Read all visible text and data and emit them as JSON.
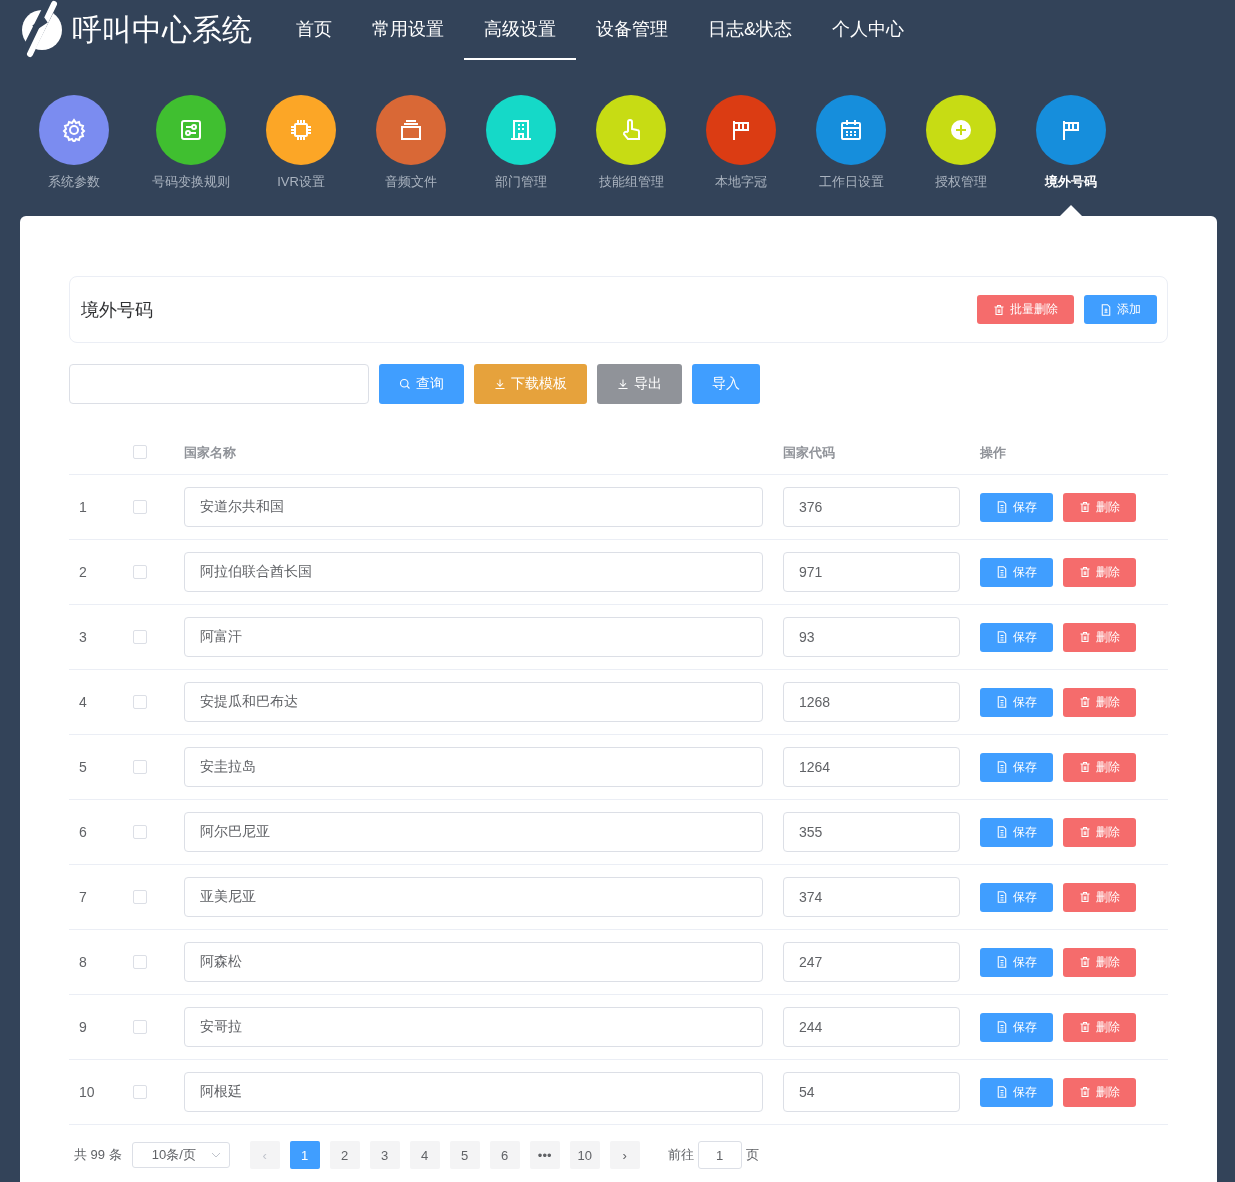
{
  "app": {
    "title": "呼叫中心系统"
  },
  "nav": [
    {
      "label": "首页",
      "selected": false
    },
    {
      "label": "常用设置",
      "selected": false
    },
    {
      "label": "高级设置",
      "selected": true
    },
    {
      "label": "设备管理",
      "selected": false
    },
    {
      "label": "日志&状态",
      "selected": false
    },
    {
      "label": "个人中心",
      "selected": false
    }
  ],
  "modules": [
    {
      "label": "系统参数",
      "color": "#7b8cf0",
      "selected": false
    },
    {
      "label": "号码变换规则",
      "color": "#40bf30",
      "selected": false
    },
    {
      "label": "IVR设置",
      "color": "#fca626",
      "selected": false
    },
    {
      "label": "音频文件",
      "color": "#d96836",
      "selected": false
    },
    {
      "label": "部门管理",
      "color": "#15d9c8",
      "selected": false
    },
    {
      "label": "技能组管理",
      "color": "#c7dc14",
      "selected": false
    },
    {
      "label": "本地字冠",
      "color": "#db3c13",
      "selected": false
    },
    {
      "label": "工作日设置",
      "color": "#168edc",
      "selected": false
    },
    {
      "label": "授权管理",
      "color": "#c7dc14",
      "selected": false
    },
    {
      "label": "境外号码",
      "color": "#168edc",
      "selected": true
    }
  ],
  "panel": {
    "title": "境外号码",
    "actions": [
      {
        "label": "批量删除",
        "kind": "danger"
      },
      {
        "label": "添加",
        "kind": "primary"
      }
    ]
  },
  "toolbar": {
    "buttons": [
      {
        "label": "查询",
        "kind": "primary"
      },
      {
        "label": "下载模板",
        "kind": "warning"
      },
      {
        "label": "导出",
        "kind": "info"
      },
      {
        "label": "导入",
        "kind": "primary"
      }
    ]
  },
  "table": {
    "columns": [
      "国家名称",
      "国家代码",
      "操作"
    ],
    "header_checked": false,
    "rows": [
      {
        "index": "1",
        "checked": false,
        "name": "安道尔共和国",
        "code": "376",
        "actions": [
          {
            "label": "保存",
            "kind": "primary"
          },
          {
            "label": "删除",
            "kind": "danger"
          }
        ]
      },
      {
        "index": "2",
        "checked": false,
        "name": "阿拉伯联合酋长国",
        "code": "971",
        "actions": [
          {
            "label": "保存",
            "kind": "primary"
          },
          {
            "label": "删除",
            "kind": "danger"
          }
        ]
      },
      {
        "index": "3",
        "checked": false,
        "name": "阿富汗",
        "code": "93",
        "actions": [
          {
            "label": "保存",
            "kind": "primary"
          },
          {
            "label": "删除",
            "kind": "danger"
          }
        ]
      },
      {
        "index": "4",
        "checked": false,
        "name": "安提瓜和巴布达",
        "code": "1268",
        "actions": [
          {
            "label": "保存",
            "kind": "primary"
          },
          {
            "label": "删除",
            "kind": "danger"
          }
        ]
      },
      {
        "index": "5",
        "checked": false,
        "name": "安圭拉岛",
        "code": "1264",
        "actions": [
          {
            "label": "保存",
            "kind": "primary"
          },
          {
            "label": "删除",
            "kind": "danger"
          }
        ]
      },
      {
        "index": "6",
        "checked": false,
        "name": "阿尔巴尼亚",
        "code": "355",
        "actions": [
          {
            "label": "保存",
            "kind": "primary"
          },
          {
            "label": "删除",
            "kind": "danger"
          }
        ]
      },
      {
        "index": "7",
        "checked": false,
        "name": "亚美尼亚",
        "code": "374",
        "actions": [
          {
            "label": "保存",
            "kind": "primary"
          },
          {
            "label": "删除",
            "kind": "danger"
          }
        ]
      },
      {
        "index": "8",
        "checked": false,
        "name": "阿森松",
        "code": "247",
        "actions": [
          {
            "label": "保存",
            "kind": "primary"
          },
          {
            "label": "删除",
            "kind": "danger"
          }
        ]
      },
      {
        "index": "9",
        "checked": false,
        "name": "安哥拉",
        "code": "244",
        "actions": [
          {
            "label": "保存",
            "kind": "primary"
          },
          {
            "label": "删除",
            "kind": "danger"
          }
        ]
      },
      {
        "index": "10",
        "checked": false,
        "name": "阿根廷",
        "code": "54",
        "actions": [
          {
            "label": "保存",
            "kind": "primary"
          },
          {
            "label": "删除",
            "kind": "danger"
          }
        ]
      }
    ]
  },
  "pagination": {
    "total": "共 99 条",
    "page_size": "10条/页",
    "prev": "‹",
    "next": "›",
    "pages": [
      {
        "label": "1",
        "selected": true
      },
      {
        "label": "2",
        "selected": false
      },
      {
        "label": "3",
        "selected": false
      },
      {
        "label": "4",
        "selected": false
      },
      {
        "label": "5",
        "selected": false
      },
      {
        "label": "6",
        "selected": false
      },
      {
        "label": "•••",
        "selected": false
      },
      {
        "label": "10",
        "selected": false
      }
    ],
    "goto_label": "前往",
    "goto_value": "1",
    "goto_unit": "页"
  }
}
